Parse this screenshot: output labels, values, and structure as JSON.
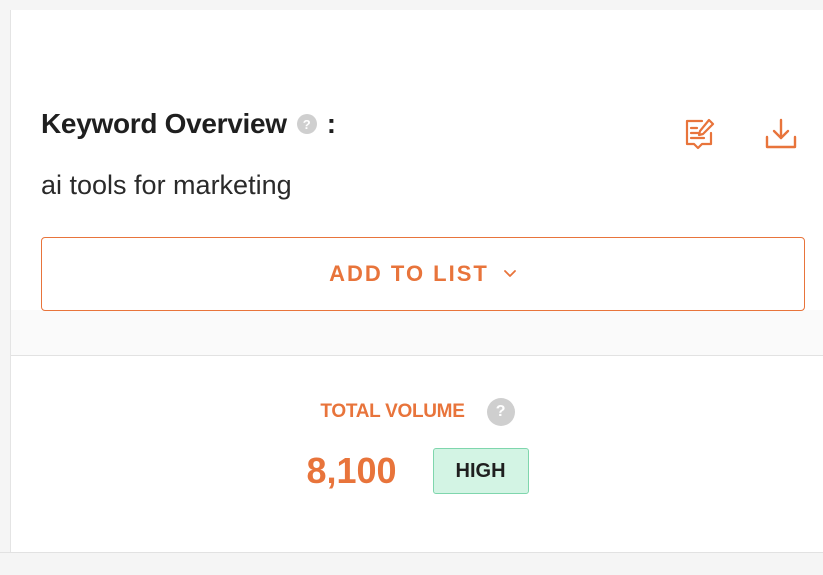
{
  "overview": {
    "title": "Keyword Overview",
    "help_glyph": "?",
    "colon": ":",
    "keyword": "ai tools for marketing",
    "notes_icon": "notes-edit-icon",
    "download_icon": "download-icon"
  },
  "add_to_list": {
    "label": "ADD TO LIST",
    "chevron_icon": "chevron-down-icon"
  },
  "volume": {
    "label": "TOTAL VOLUME",
    "help_glyph": "?",
    "value": "8,100",
    "level": "HIGH"
  },
  "colors": {
    "accent": "#e8743b",
    "badge_bg": "#d3f4e4",
    "badge_border": "#7fd6ad",
    "help_dot": "#cfcfcf"
  }
}
